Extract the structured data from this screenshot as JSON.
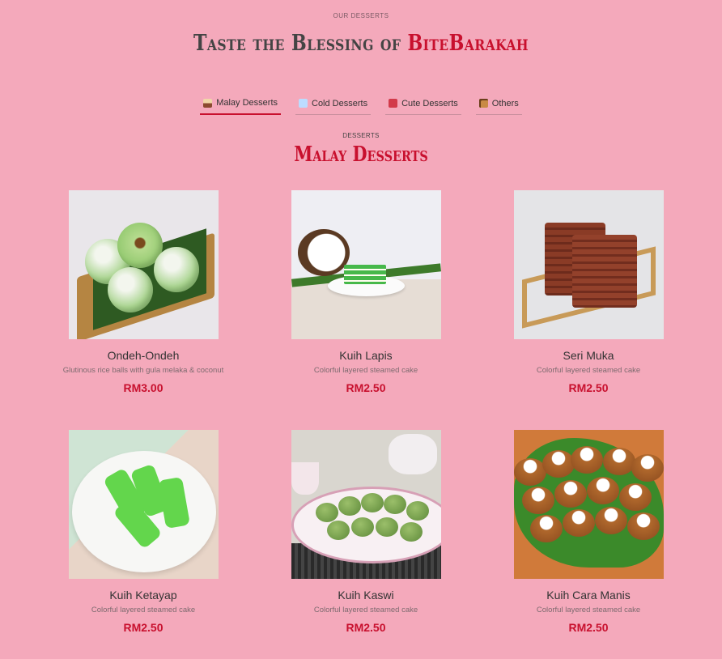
{
  "header": {
    "eyebrow": "OUR DESSERTS",
    "title_prefix": "Taste the Blessing of ",
    "title_brand": "BiteBarakah"
  },
  "tabs": [
    {
      "label": "Malay Desserts",
      "icon": "layered-cake-icon",
      "active": true
    },
    {
      "label": "Cold Desserts",
      "icon": "snowflake-icon",
      "active": false
    },
    {
      "label": "Cute Desserts",
      "icon": "strawberry-icon",
      "active": false
    },
    {
      "label": "Others",
      "icon": "cookie-icon",
      "active": false
    }
  ],
  "section": {
    "eyebrow": "DESSERTS",
    "title": "Malay Desserts"
  },
  "items": [
    {
      "name": "Ondeh-Ondeh",
      "description": "Glutinous rice balls with gula melaka & coconut",
      "price": "RM3.00"
    },
    {
      "name": "Kuih Lapis",
      "description": "Colorful layered steamed cake",
      "price": "RM2.50"
    },
    {
      "name": "Seri Muka",
      "description": "Colorful layered steamed cake",
      "price": "RM2.50"
    },
    {
      "name": "Kuih Ketayap",
      "description": "Colorful layered steamed cake",
      "price": "RM2.50"
    },
    {
      "name": "Kuih Kaswi",
      "description": "Colorful layered steamed cake",
      "price": "RM2.50"
    },
    {
      "name": "Kuih Cara Manis",
      "description": "Colorful layered steamed cake",
      "price": "RM2.50"
    }
  ],
  "colors": {
    "background": "#f4a9bb",
    "accent": "#c8102e",
    "text": "#333333"
  }
}
